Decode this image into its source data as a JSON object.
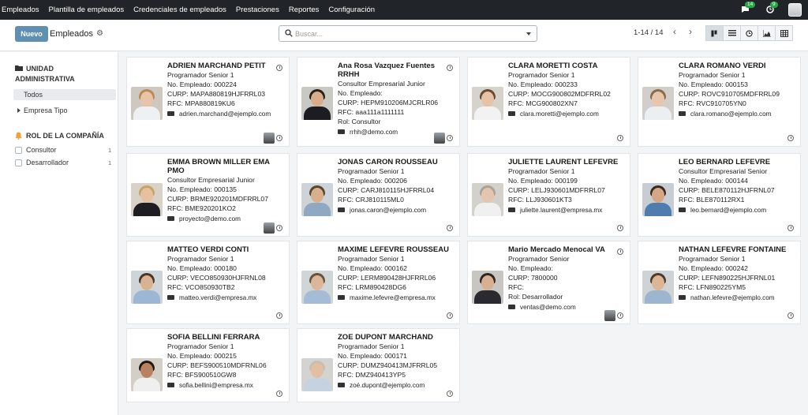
{
  "nav": {
    "menu": [
      "Empleados",
      "Plantilla de empleados",
      "Credenciales de empleados",
      "Prestaciones",
      "Reportes",
      "Configuración"
    ],
    "messages_count": "14",
    "activities_count": "9"
  },
  "control": {
    "new_label": "Nuevo",
    "title": "Empleados",
    "search_placeholder": "Buscar...",
    "pager": "1-14 / 14"
  },
  "sidebar": {
    "section1_title_1": "UNIDAD",
    "section1_title_2": "ADMINISTRATIVA",
    "all_label": "Todos",
    "company_label": "Empresa Tipo",
    "section2_title": "ROL DE LA COMPAÑÍA",
    "roles": [
      {
        "label": "Consultor",
        "count": "1"
      },
      {
        "label": "Desarrollador",
        "count": "1"
      }
    ]
  },
  "employees": [
    {
      "name": "ADRIEN MARCHAND PETIT",
      "job": "Programador Senior 1",
      "number": "No. Empleado: 000224",
      "curp": "CURP: MAPA880819HJFRRL03",
      "rfc": "RFC: MPA880819KU6",
      "email": "adrien.marchand@ejemplo.com"
    },
    {
      "name": "Ana Rosa Vazquez Fuentes RRHH",
      "job": "Consultor Empresarial Junior",
      "number": "No. Empleado:",
      "curp": "CURP: HEPM910206MJCRLR06",
      "rfc": "RFC: aaa111a1111111",
      "role": "Rol: Consultor",
      "email": "rrhh@demo.com"
    },
    {
      "name": "CLARA MORETTI COSTA",
      "job": "Programador Senior 1",
      "number": "No. Empleado: 000233",
      "curp": "CURP: MOCG900802MDFRRL02",
      "rfc": "RFC: MCG900802XN7",
      "email": "clara.moretti@ejemplo.com"
    },
    {
      "name": "CLARA ROMANO VERDI",
      "job": "Programador Senior 1",
      "number": "No. Empleado: 000153",
      "curp": "CURP: ROVC910705MDFRRL09",
      "rfc": "RFC: RVC910705YN0",
      "email": "clara.romano@ejemplo.com"
    },
    {
      "name": "EMMA BROWN MILLER EMA PMO",
      "job": "Consultor Empresarial Junior",
      "number": "No. Empleado: 000135",
      "curp": "CURP: BRME920201MDFRRL07",
      "rfc": "RFC: BME920201KO2",
      "email": "proyecto@demo.com"
    },
    {
      "name": "JONAS CARON ROUSSEAU",
      "job": "Programador Senior 1",
      "number": "No. Empleado: 000206",
      "curp": "CURP: CARJ810115HJFRRL04",
      "rfc": "RFC: CRJ810115ML0",
      "email": "jonas.caron@ejemplo.com"
    },
    {
      "name": "JULIETTE LAURENT LEFEVRE",
      "job": "Programador Senior 1",
      "number": "No. Empleado: 000199",
      "curp": "CURP: LELJ930601MDFRRL07",
      "rfc": "RFC: LLJ930601KT3",
      "email": "juliette.laurent@empresa.mx"
    },
    {
      "name": "LEO BERNARD LEFEVRE",
      "job": "Consultor Empresarial Senior",
      "number": "No. Empleado: 000144",
      "curp": "CURP: BELE870112HJFRNL07",
      "rfc": "RFC: BLE870112RX1",
      "email": "leo.bernard@ejemplo.com"
    },
    {
      "name": "MATTEO VERDI CONTI",
      "job": "Programador Senior 1",
      "number": "No. Empleado: 000180",
      "curp": "CURP: VECO850930HJFRNL08",
      "rfc": "RFC: VCO850930TB2",
      "email": "matteo.verdi@empresa.mx"
    },
    {
      "name": "MAXIME LEFEVRE ROUSSEAU",
      "job": "Programador Senior 1",
      "number": "No. Empleado: 000162",
      "curp": "CURP: LERM890428HJFRRL06",
      "rfc": "RFC: LRM890428DG6",
      "email": "maxime.lefevre@empresa.mx"
    },
    {
      "name": "Mario Mercado Menocal VA",
      "job": "Programador Senior",
      "number": "No. Empleado:",
      "curp": "CURP: 7800000",
      "rfc": "RFC:",
      "role": "Rol: Desarrollador",
      "email": "ventas@demo.com"
    },
    {
      "name": "NATHAN LEFEVRE FONTAINE",
      "job": "Programador Senior 1",
      "number": "No. Empleado: 000242",
      "curp": "CURP: LEFN890225HJFRNL01",
      "rfc": "RFC: LFN890225YM5",
      "email": "nathan.lefevre@ejemplo.com"
    },
    {
      "name": "SOFIA BELLINI FERRARA",
      "job": "Programador Senior 1",
      "number": "No. Empleado: 000215",
      "curp": "CURP: BEFS900510MDFRNL06",
      "rfc": "RFC: BFS900510GW8",
      "email": "sofia.bellini@empresa.mx"
    },
    {
      "name": "ZOE DUPONT MARCHAND",
      "job": "Programador Senior 1",
      "number": "No. Empleado: 000171",
      "curp": "CURP: DUMZ940413MJFRRL05",
      "rfc": "RFC: DMZ940413YP5",
      "email": "zoé.dupont@ejemplo.com"
    }
  ],
  "colors": {
    "topnav": "#212529",
    "new_button": "#5f8fb1",
    "badge": "#28a745"
  }
}
